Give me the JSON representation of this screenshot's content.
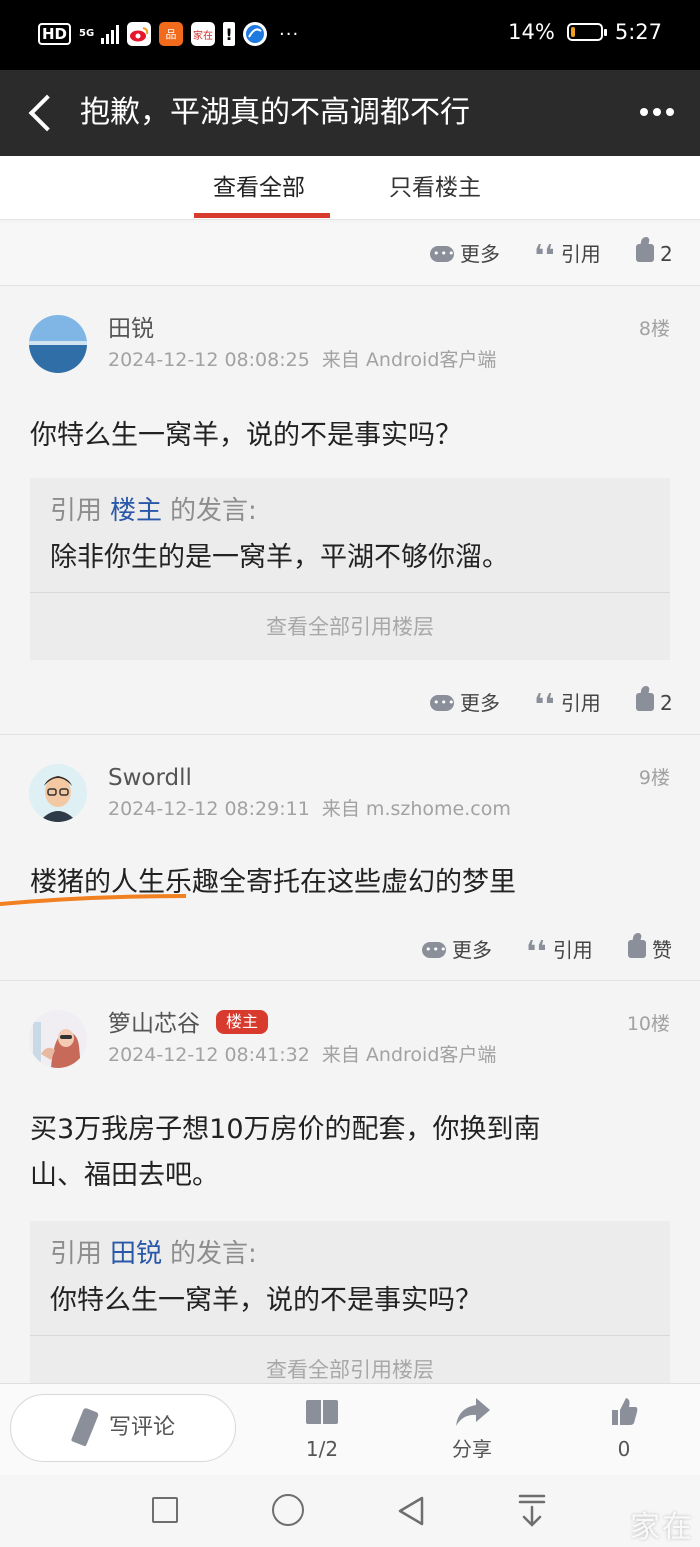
{
  "status_bar": {
    "hd": "HD",
    "network": "5G",
    "apps": [
      {
        "icon": "weibo-icon",
        "glyph": "微",
        "color": "#e6162d"
      },
      {
        "icon": "app-orange-icon",
        "glyph": "品",
        "color": "#f26b1d"
      },
      {
        "icon": "jiazai-icon",
        "glyph": "家在",
        "color": "#c9302c"
      },
      {
        "icon": "alert-icon",
        "glyph": "!",
        "color": "#ffffff"
      },
      {
        "icon": "browser-icon",
        "glyph": "",
        "color": "#1f7ae0"
      }
    ],
    "dots": "···",
    "battery_text": "14%",
    "battery_level": 0.14,
    "time": "5:27"
  },
  "header": {
    "title": "抱歉，平湖真的不高调都不行"
  },
  "tabs": [
    {
      "label": "查看全部",
      "active": true
    },
    {
      "label": "只看楼主",
      "active": false
    }
  ],
  "top_actions": {
    "more": "更多",
    "quote": "引用",
    "like": "2"
  },
  "posts": [
    {
      "user": "田锐",
      "datetime": "2024-12-12 08:08:25",
      "source": "来自 Android客户端",
      "floor": "8楼",
      "content": "你特么生一窝羊，说的不是事实吗？",
      "quote": {
        "prefix": "引用",
        "who": "楼主",
        "suffix": "的发言:",
        "text": "除非你生的是一窝羊，平湖不够你溜。",
        "view_all": "查看全部引用楼层"
      },
      "actions": {
        "more": "更多",
        "quote": "引用",
        "like": "2"
      }
    },
    {
      "user": "Swordll",
      "datetime": "2024-12-12 08:29:11",
      "source": "来自 m.szhome.com",
      "floor": "9楼",
      "content": "楼猪的人生乐趣全寄托在这些虚幻的梦里",
      "actions": {
        "more": "更多",
        "quote": "引用",
        "like": "赞"
      }
    },
    {
      "user": "箩山芯谷",
      "badge": "楼主",
      "datetime": "2024-12-12 08:41:32",
      "source": "来自 Android客户端",
      "floor": "10楼",
      "content_line1": "买3万我房子想10万房价的配套，你换到南",
      "content_line2": "山、福田去吧。",
      "quote": {
        "prefix": "引用",
        "who": "田锐",
        "suffix": "的发言:",
        "text": "你特么生一窝羊，说的不是事实吗？",
        "view_all": "查看全部引用楼层"
      }
    }
  ],
  "bottom_bar": {
    "write": "写评论",
    "page": "1/2",
    "share": "分享",
    "likes": "0"
  },
  "watermark": "家在"
}
